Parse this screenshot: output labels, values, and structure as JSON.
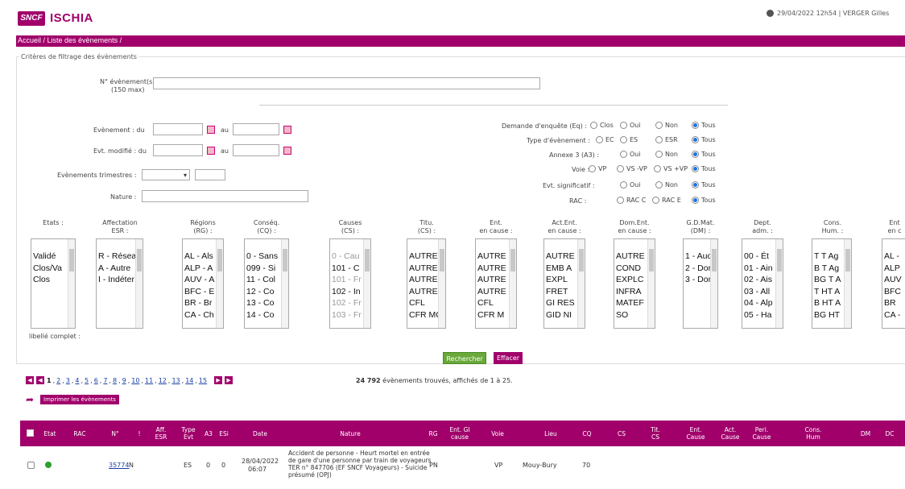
{
  "header": {
    "logo_text": "SNCF",
    "app_name": "ISCHIA",
    "user_info": "29/04/2022 12h54 | VERGER Gilles"
  },
  "breadcrumb": {
    "home": "Accueil",
    "separator": " / ",
    "current": "Liste des évènements",
    "trail": " /"
  },
  "filters": {
    "legend": "Critères de filtrage des évènements",
    "event_numbers_label": "N° évènement(s) :",
    "event_numbers_hint": "(150 max)",
    "evenement_du_label": "Evènement : du",
    "au_label": "au",
    "evt_modifie_label": "Evt. modifié : du",
    "au_label_2": "au",
    "trimestres_label": "Evènements trimestres :",
    "nature_label": "Nature :",
    "demande_enquete": {
      "label": "Demande d'enquête (Eq) :",
      "options": [
        "Clos",
        "Oui",
        "Non",
        "Tous"
      ],
      "selected": "Tous"
    },
    "type_evenement": {
      "label": "Type d'évènement :",
      "options": [
        "EC",
        "ES",
        "ESR",
        "Tous"
      ],
      "selected": "Tous"
    },
    "annexe3": {
      "label": "Annexe 3 (A3) :",
      "options": [
        "Oui",
        "Non",
        "Tous"
      ],
      "selected": "Tous"
    },
    "voie": {
      "label": "Voie :",
      "options": [
        "VP",
        "VS -VP",
        "VS +VP",
        "Tous"
      ],
      "selected": "Tous"
    },
    "evt_significatif": {
      "label": "Evt. significatif :",
      "options": [
        "Oui",
        "Non",
        "Tous"
      ],
      "selected": "Tous"
    },
    "rac": {
      "label": "RAC :",
      "options": [
        "RAC C",
        "RAC E",
        "Tous"
      ],
      "selected": "Tous"
    },
    "libelle_complet_label": "libellé complet :",
    "search_button": "Rechercher",
    "clear_button": "Effacer"
  },
  "lists": [
    {
      "head1": "Etats :",
      "head2": "",
      "options": [
        "Validé",
        "Clos/Va",
        "Clos"
      ]
    },
    {
      "head1": "Affectation",
      "head2": "ESR :",
      "options": [
        "R - Résea",
        "A - Autre",
        "I - Indéter"
      ]
    },
    {
      "head1": "Régions",
      "head2": "(RG) :",
      "options": [
        "AL - Als",
        "ALP - A",
        "AUV - A",
        "BFC - E",
        "BR - Br",
        "CA - Ch"
      ]
    },
    {
      "head1": "Conséq.",
      "head2": "(CQ) :",
      "options": [
        "0 - Sans",
        "099 - Si",
        "11 - Col",
        "12 - Co",
        "13 - Co",
        "14 - Co"
      ]
    },
    {
      "head1": "Causes",
      "head2": "(CS) :",
      "options": [
        "0 - Cau",
        "101 - C",
        "101 - Fr",
        "102 - In",
        "102 - Fr",
        "103 - Fr"
      ]
    },
    {
      "head1": "Titu.",
      "head2": "(CS) :",
      "options": [
        "AUTRE",
        "AUTRE",
        "AUTRE",
        "AUTRE",
        "CFL",
        "CFR MC"
      ]
    },
    {
      "head1": "Ent.",
      "head2": "en cause :",
      "options": [
        "AUTRE",
        "AUTRE",
        "AUTRE",
        "AUTRE",
        "CFL",
        "CFR M"
      ]
    },
    {
      "head1": "Act.Ent.",
      "head2": "en cause :",
      "options": [
        "AUTRE",
        "EMB A",
        "EXPL",
        "FRET",
        "GI RES",
        "GID NI"
      ]
    },
    {
      "head1": "Dom.Ent.",
      "head2": "en cause :",
      "options": [
        "AUTRE",
        "COND",
        "EXPLC",
        "INFRA",
        "MATEF",
        "SO"
      ]
    },
    {
      "head1": "G.D.Mat.",
      "head2": "(DM) :",
      "options": [
        "1 - Auc",
        "2 - Dor",
        "3 - Dor"
      ]
    },
    {
      "head1": "Dept.",
      "head2": "adm. :",
      "options": [
        "00 - Ét",
        "01 - Ain",
        "02 - Ais",
        "03 - All",
        "04 - Alp",
        "05 - Ha"
      ]
    },
    {
      "head1": "Cons.",
      "head2": "Hum. :",
      "options": [
        "T T Ag",
        "B T Ag",
        "BG T A",
        "T HT A",
        "B HT A",
        "BG HT"
      ]
    },
    {
      "head1": "Ent",
      "head2": "en c",
      "options": [
        "AL -",
        "ALP",
        "AUV",
        "BFC",
        "BR",
        "CA -"
      ]
    }
  ],
  "pager": {
    "pages": [
      "1",
      "2",
      "3",
      "4",
      "5",
      "6",
      "7",
      "8",
      "9",
      "10",
      "11",
      "12",
      "13",
      "14",
      "15"
    ],
    "current": "1",
    "found_count": "24 792",
    "found_text": " évènements trouvés, affichés de 1 à 25."
  },
  "print_button": "Imprimer les évènements",
  "table": {
    "columns": [
      "Etat",
      "RAC",
      "N°",
      "!",
      "Aff. ESR",
      "Type Evt",
      "A3",
      "ESi",
      "Date",
      "Nature",
      "RG",
      "Ent. GI cause",
      "Voie",
      "Lieu",
      "CQ",
      "CS",
      "Tit. CS",
      "Ent. Cause",
      "Act. Cause",
      "Peri. Cause",
      "Cons. Hum",
      "DM",
      "DC"
    ],
    "rows": [
      {
        "numero": "35774",
        "flag": "N",
        "type": "ES",
        "a3": "0",
        "esi": "0",
        "date": "28/04/2022",
        "time": "06:07",
        "nature": "Accident de personne - Heurt mortel en entrée de gare d'une personne par train de voyageurs TER n° 847706 (EF SNCF Voyageurs) - Suicide présumé (OPJ)",
        "rg": "PN",
        "voie": "VP",
        "lieu": "Mouy-Bury",
        "cq": "70",
        "status_color": "#2ca02c"
      }
    ]
  }
}
